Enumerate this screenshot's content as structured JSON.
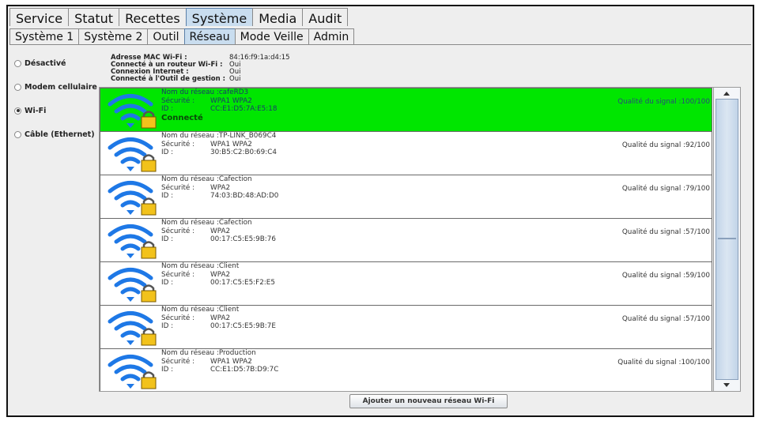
{
  "tabs_main": [
    "Service",
    "Statut",
    "Recettes",
    "Système",
    "Media",
    "Audit"
  ],
  "tabs_sub": [
    "Système 1",
    "Système 2",
    "Outil",
    "Réseau",
    "Mode Veille",
    "Admin"
  ],
  "connection_options": [
    {
      "label": "Désactivé",
      "selected": false
    },
    {
      "label": "Modem cellulaire",
      "selected": false
    },
    {
      "label": "Wi-Fi",
      "selected": true
    },
    {
      "label": "Câble (Ethernet)",
      "selected": false
    }
  ],
  "info": {
    "mac_label": "Adresse MAC Wi-Fi :",
    "mac_value": "84:16:f9:1a:d4:15",
    "router_label": "Connecté à un routeur Wi-Fi :",
    "router_value": "Oui",
    "internet_label": "Connexion Internet :",
    "internet_value": "Oui",
    "tool_label": "Connecté à l'Outil de gestion :",
    "tool_value": "Oui"
  },
  "labels": {
    "network_name": "Nom du réseau :",
    "security": "Sécurité :",
    "id": "ID :",
    "signal_quality": "Qualité du signal :",
    "connected": "Connecté"
  },
  "networks": [
    {
      "name": "cafeRD3",
      "security": "WPA1 WPA2",
      "id": "CC:E1:D5:7A:E5:18",
      "quality": "100/100",
      "connected": true
    },
    {
      "name": "TP-LINK_B069C4",
      "security": "WPA1 WPA2",
      "id": "30:B5:C2:B0:69:C4",
      "quality": "92/100",
      "connected": false
    },
    {
      "name": "Cafection",
      "security": "WPA2",
      "id": "74:03:BD:48:AD:D0",
      "quality": "79/100",
      "connected": false
    },
    {
      "name": "Cafection",
      "security": "WPA2",
      "id": "00:17:C5:E5:9B:76",
      "quality": "57/100",
      "connected": false
    },
    {
      "name": "Client",
      "security": "WPA2",
      "id": "00:17:C5:E5:F2:E5",
      "quality": "59/100",
      "connected": false
    },
    {
      "name": "Client",
      "security": "WPA2",
      "id": "00:17:C5:E5:9B:7E",
      "quality": "57/100",
      "connected": false
    },
    {
      "name": "Production",
      "security": "WPA1 WPA2",
      "id": "CC:E1:D5:7B:D9:7C",
      "quality": "100/100",
      "connected": false
    }
  ],
  "add_button": "Ajouter un nouveau réseau Wi-Fi",
  "colors": {
    "connected_bg": "#00e600",
    "wifi_blue": "#1e78e6",
    "lock_yellow": "#f2c21b"
  },
  "icons": {
    "wifi": "wifi-icon",
    "lock": "lock-icon"
  }
}
